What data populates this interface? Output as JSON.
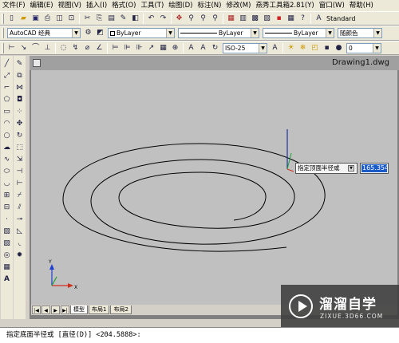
{
  "menu": [
    "文件(F)",
    "编辑(E)",
    "视图(V)",
    "插入(I)",
    "格式(O)",
    "工具(T)",
    "绘图(D)",
    "标注(N)",
    "修改(M)",
    "燕秀工具箱2.81(Y)",
    "窗口(W)",
    "帮助(H)"
  ],
  "toolbar1": {
    "text_style": "Standard"
  },
  "toolbar2": {
    "workspace": "AutoCAD 经典",
    "layer": "ByLayer",
    "linetype": "ByLayer",
    "lineweight": "ByLayer",
    "plot_style": "随颜色"
  },
  "toolbar3": {
    "dim_style": "ISO-25"
  },
  "drawing": {
    "title": "Drawing1.dwg"
  },
  "tabs": {
    "model": "模型",
    "layout1": "布局1",
    "layout2": "布局2"
  },
  "dynamic_input": {
    "prompt": "指定顶面半径或",
    "value": "165.3549"
  },
  "command_line": "指定底面半径或 [直径(D)] <204.5888>:",
  "ucs": {
    "x": "X",
    "y": "Y"
  },
  "watermark": {
    "brand": "溜溜自学",
    "url": "ZIXUE.3D66.COM"
  },
  "icons": {
    "draw": [
      "line-icon",
      "xline-icon",
      "polyline-icon",
      "polygon-icon",
      "rectangle-icon",
      "arc-icon",
      "circle-icon",
      "revcloud-icon",
      "spline-icon",
      "ellipse-icon",
      "ellipse-arc-icon",
      "insert-block-icon",
      "make-block-icon",
      "point-icon",
      "hatch-icon",
      "gradient-icon",
      "region-icon",
      "table-icon",
      "mtext-icon"
    ],
    "modify": [
      "erase-icon",
      "copy-icon",
      "mirror-icon",
      "offset-icon",
      "array-icon",
      "move-icon",
      "rotate-icon",
      "scale-icon",
      "stretch-icon",
      "trim-icon",
      "extend-icon",
      "break-at-point-icon",
      "break-icon",
      "join-icon",
      "chamfer-icon",
      "fillet-icon",
      "explode-icon"
    ]
  },
  "colors": {
    "canvas": "#c0c0c0",
    "highlight": "#1a5bc8",
    "ucs_x": "#d03020",
    "ucs_y": "#20a030",
    "ucs_z": "#2040d0"
  }
}
